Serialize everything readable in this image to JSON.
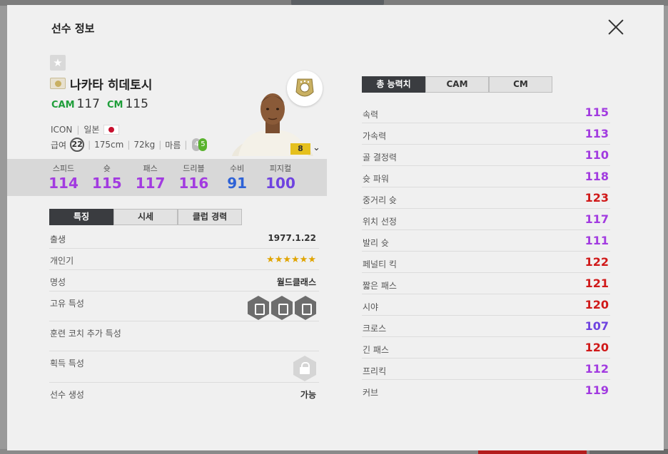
{
  "modal": {
    "title": "선수 정보"
  },
  "player": {
    "name": "나카타 히데토시",
    "positions": [
      {
        "pos": "CAM",
        "ovr": "117"
      },
      {
        "pos": "CM",
        "ovr": "115"
      }
    ],
    "season": "ICON",
    "nation": "일본",
    "salary": "22",
    "height": "175cm",
    "weight": "72kg",
    "body_type": "마름",
    "weak_foot_left": "4",
    "weak_foot_right": "5",
    "enhance_level": "8"
  },
  "main_stats": [
    {
      "label": "스피드",
      "value": "114",
      "color": "#a23be0"
    },
    {
      "label": "슛",
      "value": "115",
      "color": "#a23be0"
    },
    {
      "label": "패스",
      "value": "117",
      "color": "#a23be0"
    },
    {
      "label": "드리블",
      "value": "116",
      "color": "#a23be0"
    },
    {
      "label": "수비",
      "value": "91",
      "color": "#2e62d6"
    },
    {
      "label": "피지컬",
      "value": "100",
      "color": "#6f43e0"
    }
  ],
  "left_tabs": [
    "특징",
    "시세",
    "클럽 경력"
  ],
  "info": {
    "birth_label": "출생",
    "birth_value": "1977.1.22",
    "popularity_label": "개인기",
    "popularity_stars": "★★★★★★",
    "reputation_label": "명성",
    "reputation_value": "월드클래스",
    "traits_label": "고유 특성",
    "coach_label": "훈련 코치 추가 특성",
    "acquired_label": "획득 특성",
    "generate_label": "선수 생성",
    "generate_value": "가능"
  },
  "right_tabs": [
    "총 능력치",
    "CAM",
    "CM"
  ],
  "attributes": [
    {
      "label": "속력",
      "value": "115",
      "color": "#a23be0"
    },
    {
      "label": "가속력",
      "value": "113",
      "color": "#a23be0"
    },
    {
      "label": "골 결정력",
      "value": "110",
      "color": "#a23be0"
    },
    {
      "label": "슛 파워",
      "value": "118",
      "color": "#a23be0"
    },
    {
      "label": "중거리 슛",
      "value": "123",
      "color": "#d01919"
    },
    {
      "label": "위치 선정",
      "value": "117",
      "color": "#a23be0"
    },
    {
      "label": "발리 슛",
      "value": "111",
      "color": "#a23be0"
    },
    {
      "label": "페널티 킥",
      "value": "122",
      "color": "#d01919"
    },
    {
      "label": "짧은 패스",
      "value": "121",
      "color": "#d01919"
    },
    {
      "label": "시야",
      "value": "120",
      "color": "#d01919"
    },
    {
      "label": "크로스",
      "value": "107",
      "color": "#6f43e0"
    },
    {
      "label": "긴 패스",
      "value": "120",
      "color": "#d01919"
    },
    {
      "label": "프리킥",
      "value": "112",
      "color": "#a23be0"
    },
    {
      "label": "커브",
      "value": "119",
      "color": "#a23be0"
    }
  ]
}
